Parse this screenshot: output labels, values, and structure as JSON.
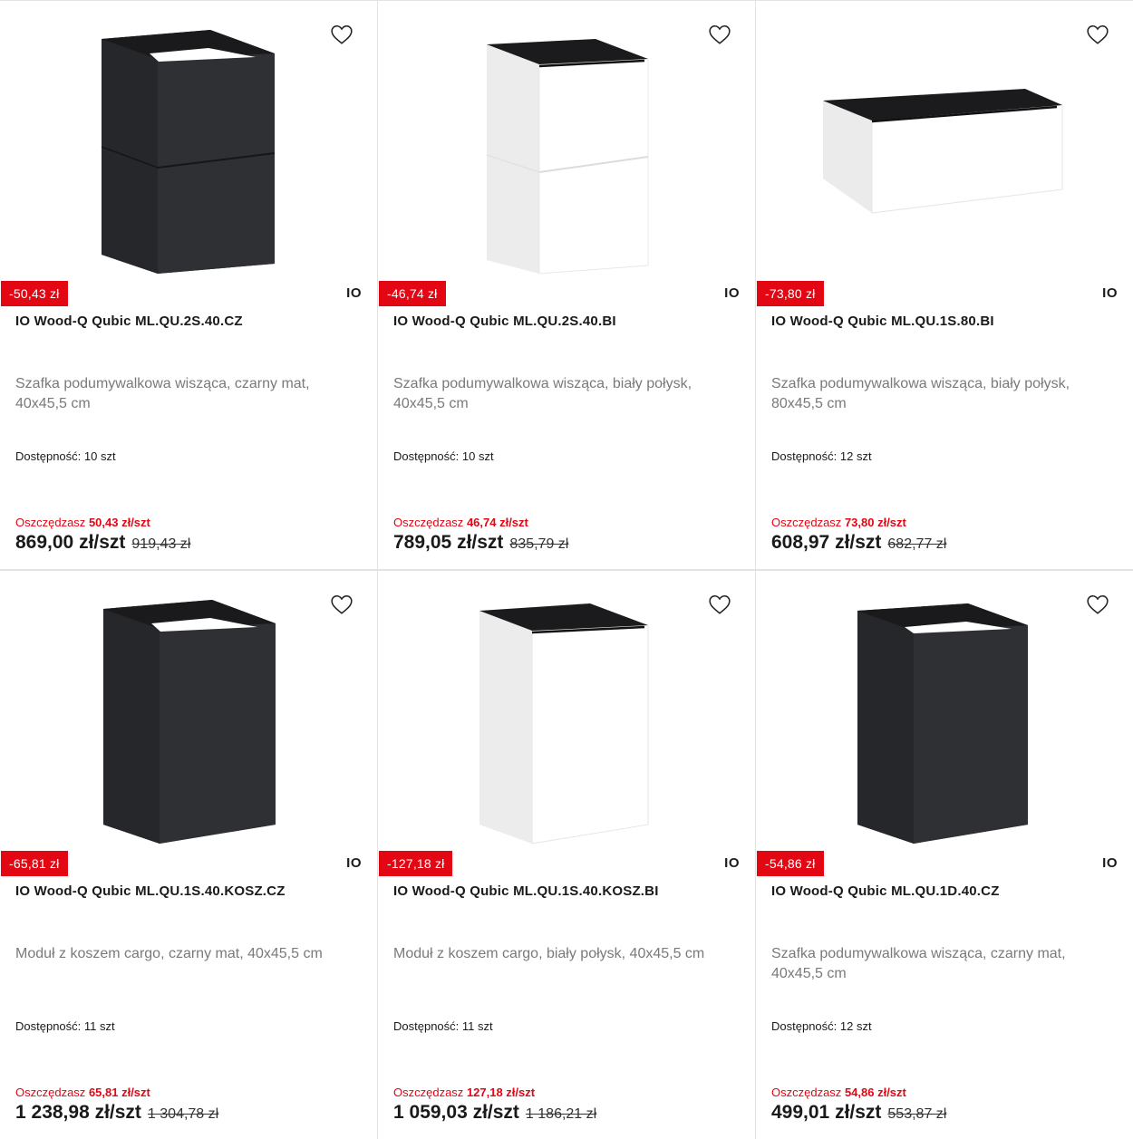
{
  "products": [
    {
      "discount": "-50,43 zł",
      "brand": "IO",
      "title": "IO Wood-Q Qubic ML.QU.2S.40.CZ",
      "description": "Szafka podumywalkowa wisząca, czarny mat, 40x45,5 cm",
      "availability": "Dostępność: 10 szt",
      "save_label": "Oszczędzasz",
      "save_amount": "50,43 zł/szt",
      "price": "869,00 zł/szt",
      "old_price": "919,43 zł",
      "image": {
        "shape": "two-drawer-tall",
        "color": "#2b2c30"
      }
    },
    {
      "discount": "-46,74 zł",
      "brand": "IO",
      "title": "IO Wood-Q Qubic ML.QU.2S.40.BI",
      "description": "Szafka podumywalkowa wisząca, biały połysk, 40x45,5 cm",
      "availability": "Dostępność: 10 szt",
      "save_label": "Oszczędzasz",
      "save_amount": "46,74 zł/szt",
      "price": "789,05 zł/szt",
      "old_price": "835,79 zł",
      "image": {
        "shape": "two-drawer-tall",
        "color": "#ffffff"
      }
    },
    {
      "discount": "-73,80 zł",
      "brand": "IO",
      "title": "IO Wood-Q Qubic ML.QU.1S.80.BI",
      "description": "Szafka podumywalkowa wisząca, biały połysk, 80x45,5 cm",
      "availability": "Dostępność: 12 szt",
      "save_label": "Oszczędzasz",
      "save_amount": "73,80 zł/szt",
      "price": "608,97 zł/szt",
      "old_price": "682,77 zł",
      "image": {
        "shape": "wide-drawer",
        "color": "#ffffff"
      }
    },
    {
      "discount": "-65,81 zł",
      "brand": "IO",
      "title": "IO Wood-Q Qubic ML.QU.1S.40.KOSZ.CZ",
      "description": "Moduł z koszem cargo, czarny mat, 40x45,5 cm",
      "availability": "Dostępność: 11 szt",
      "save_label": "Oszczędzasz",
      "save_amount": "65,81 zł/szt",
      "price": "1 238,98 zł/szt",
      "old_price": "1 304,78 zł",
      "image": {
        "shape": "single-front-tall",
        "color": "#2b2c30"
      }
    },
    {
      "discount": "-127,18 zł",
      "brand": "IO",
      "title": "IO Wood-Q Qubic ML.QU.1S.40.KOSZ.BI",
      "description": "Moduł z koszem cargo, biały połysk, 40x45,5 cm",
      "availability": "Dostępność: 11 szt",
      "save_label": "Oszczędzasz",
      "save_amount": "127,18 zł/szt",
      "price": "1 059,03 zł/szt",
      "old_price": "1 186,21 zł",
      "image": {
        "shape": "single-front-tall",
        "color": "#ffffff"
      }
    },
    {
      "discount": "-54,86 zł",
      "brand": "IO",
      "title": "IO Wood-Q Qubic ML.QU.1D.40.CZ",
      "description": "Szafka podumywalkowa wisząca, czarny mat, 40x45,5 cm",
      "availability": "Dostępność: 12 szt",
      "save_label": "Oszczędzasz",
      "save_amount": "54,86 zł/szt",
      "price": "499,01 zł/szt",
      "old_price": "553,87 zł",
      "image": {
        "shape": "single-door-tall",
        "color": "#2b2c30"
      }
    }
  ],
  "icons": {
    "favorite": "heart-outline-icon"
  }
}
